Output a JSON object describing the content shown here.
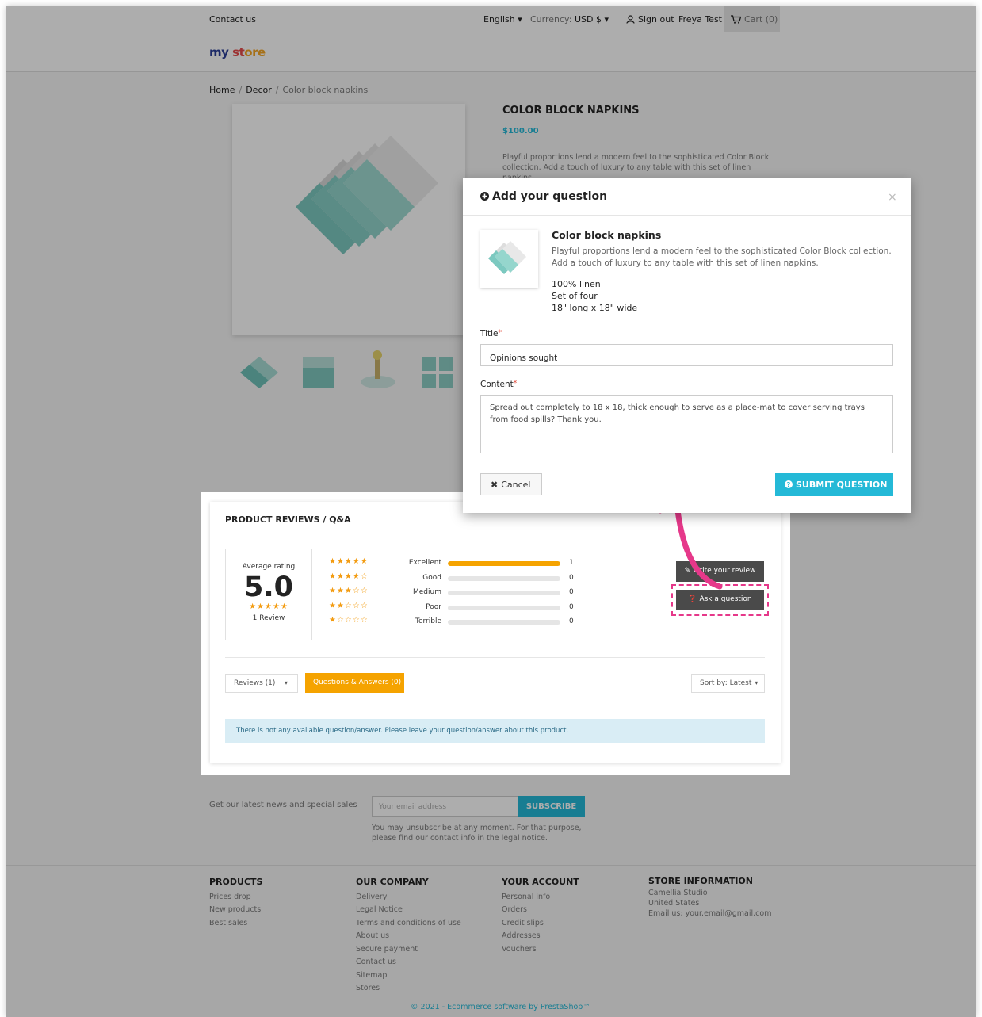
{
  "topnav": {
    "contact": "Contact us",
    "language": "English ▾",
    "currency_label": "Currency:",
    "currency_value": "USD $ ▾",
    "sign_out": "Sign out",
    "user_name": "Freya Test",
    "cart": "Cart (0)"
  },
  "logo": {
    "part1": "my",
    "part2": "st",
    "part3": "ore"
  },
  "breadcrumb": {
    "home": "Home",
    "decor": "Decor",
    "current": "Color block napkins"
  },
  "product": {
    "title": "COLOR BLOCK NAPKINS",
    "price": "$100.00",
    "description": "Playful proportions lend a modern feel to the sophisticated Color Block collection. Add a touch of luxury to any table with this set of linen napkins."
  },
  "reviews": {
    "title": "PRODUCT REVIEWS / Q&A",
    "avg_label": "Average rating",
    "avg_value": "5.0",
    "avg_stars": "★★★★★",
    "review_count": "1 Review",
    "distribution": [
      {
        "stars": "★★★★★",
        "label": "Excellent",
        "count": "1",
        "fraction": 1.0
      },
      {
        "stars": "★★★★☆",
        "label": "Good",
        "count": "0",
        "fraction": 0
      },
      {
        "stars": "★★★☆☆",
        "label": "Medium",
        "count": "0",
        "fraction": 0
      },
      {
        "stars": "★★☆☆☆",
        "label": "Poor",
        "count": "0",
        "fraction": 0
      },
      {
        "stars": "★☆☆☆☆",
        "label": "Terrible",
        "count": "0",
        "fraction": 0
      }
    ],
    "write_review": "✎ Write your review",
    "ask_question": "❓ Ask a question",
    "reviews_select": "Reviews (1)",
    "qa_tab": "Questions & Answers (0)",
    "sort": "Sort by: Latest",
    "alert": "There is not any available question/answer. Please leave your question/answer about this product."
  },
  "modal": {
    "title": "Add your question",
    "close": "×",
    "product_name": "Color block napkins",
    "product_desc": "Playful proportions lend a modern feel to the sophisticated Color Block collection. Add a touch of luxury to any table with this set of linen napkins.",
    "spec1": "100% linen",
    "spec2": "Set of four",
    "spec3": "18\" long x 18\" wide",
    "title_label": "Title",
    "title_value": "Opinions sought",
    "content_label": "Content",
    "content_value": "Spread out completely to 18 x 18, thick enough to serve as a place-mat to cover serving trays from food spills? Thank you.",
    "cancel": "Cancel",
    "submit": "SUBMIT QUESTION"
  },
  "footer": {
    "news_text": "Get our latest news and special sales",
    "email_placeholder": "Your email address",
    "subscribe": "SUBSCRIBE",
    "news_note": "You may unsubscribe at any moment. For that purpose, please find our contact info in the legal notice.",
    "products_title": "PRODUCTS",
    "products": [
      "Prices drop",
      "New products",
      "Best sales"
    ],
    "company_title": "OUR COMPANY",
    "company": [
      "Delivery",
      "Legal Notice",
      "Terms and conditions of use",
      "About us",
      "Secure payment",
      "Contact us",
      "Sitemap",
      "Stores"
    ],
    "account_title": "YOUR ACCOUNT",
    "account": [
      "Personal info",
      "Orders",
      "Credit slips",
      "Addresses",
      "Vouchers"
    ],
    "store_title": "STORE INFORMATION",
    "store": [
      "Camellia Studio",
      "United States",
      "Email us: your.email@gmail.com"
    ],
    "copyright": "© 2021 - Ecommerce software by PrestaShop™"
  },
  "colors": {
    "accent": "#24b9d7",
    "star": "#f39c12",
    "qa_tab": "#f5a300",
    "highlight": "#e6388a"
  }
}
